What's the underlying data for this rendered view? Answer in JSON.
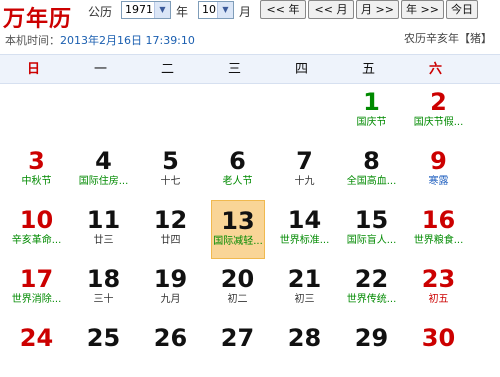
{
  "app": {
    "logo": "万年历",
    "calendar_type": "公历",
    "year_value": "1971",
    "year_label": "年",
    "month_value": "10",
    "month_label": "月",
    "buttons": [
      "<< 年",
      "<< 月",
      "月 >>",
      "年 >>",
      "今日"
    ],
    "local_time_label": "本机时间：",
    "local_time_value": "2013年2月16日 17:39:10",
    "lunar_info": "农历辛亥年【猪】"
  },
  "weekdays": [
    "日",
    "一",
    "二",
    "三",
    "四",
    "五",
    "六"
  ],
  "weeks": [
    [
      {
        "day": "",
        "sub": ""
      },
      {
        "day": "",
        "sub": ""
      },
      {
        "day": "",
        "sub": ""
      },
      {
        "day": "",
        "sub": ""
      },
      {
        "day": "",
        "sub": ""
      },
      {
        "day": "1",
        "sub": "国庆节",
        "style": "green"
      },
      {
        "day": "2",
        "sub": "国庆节假...",
        "style": "red",
        "subStyle": "green"
      }
    ],
    [
      {
        "day": "3",
        "sub": "中秋节",
        "style": "red",
        "subStyle": "green"
      },
      {
        "day": "4",
        "sub": "国际住房...",
        "subStyle": "green"
      },
      {
        "day": "5",
        "sub": "十七"
      },
      {
        "day": "6",
        "sub": "老人节",
        "subStyle": "green"
      },
      {
        "day": "7",
        "sub": "十九"
      },
      {
        "day": "8",
        "sub": "全国高血...",
        "subStyle": "green"
      },
      {
        "day": "9",
        "sub": "寒露",
        "style": "red",
        "subStyle": "blue"
      }
    ],
    [
      {
        "day": "10",
        "sub": "辛亥革命...",
        "style": "red",
        "subStyle": "green"
      },
      {
        "day": "11",
        "sub": "廿三"
      },
      {
        "day": "12",
        "sub": "廿四"
      },
      {
        "day": "13",
        "sub": "国际减轻...",
        "subStyle": "green",
        "today": true
      },
      {
        "day": "14",
        "sub": "世界标准...",
        "subStyle": "green"
      },
      {
        "day": "15",
        "sub": "国际盲人...",
        "subStyle": "green"
      },
      {
        "day": "16",
        "sub": "世界粮食...",
        "style": "red",
        "subStyle": "green"
      }
    ],
    [
      {
        "day": "17",
        "sub": "世界消除...",
        "style": "red",
        "subStyle": "green"
      },
      {
        "day": "18",
        "sub": "三十"
      },
      {
        "day": "19",
        "sub": "九月"
      },
      {
        "day": "20",
        "sub": "初二"
      },
      {
        "day": "21",
        "sub": "初三"
      },
      {
        "day": "22",
        "sub": "世界传统...",
        "subStyle": "green"
      },
      {
        "day": "23",
        "sub": "初五",
        "style": "red"
      }
    ],
    [
      {
        "day": "24",
        "sub": "",
        "style": "red"
      },
      {
        "day": "25",
        "sub": ""
      },
      {
        "day": "26",
        "sub": ""
      },
      {
        "day": "27",
        "sub": ""
      },
      {
        "day": "28",
        "sub": ""
      },
      {
        "day": "29",
        "sub": ""
      },
      {
        "day": "30",
        "sub": "",
        "style": "red"
      }
    ]
  ]
}
